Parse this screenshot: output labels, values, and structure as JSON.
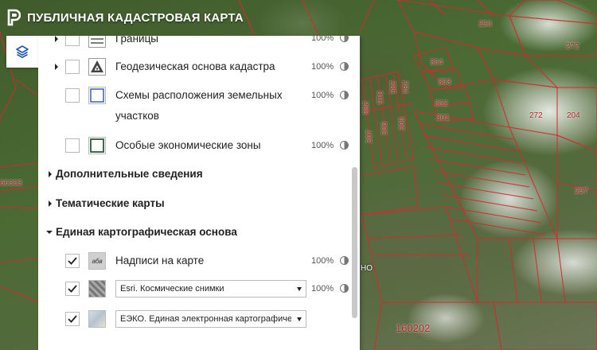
{
  "header": {
    "title": "ПУБЛИЧНАЯ КАДАСТРОВАЯ КАРТА",
    "logo_icon": "pkk-logo-icon"
  },
  "layers_button": {
    "icon": "layers-icon"
  },
  "panel": {
    "layers": [
      {
        "name": "Границы",
        "opacity": "100%",
        "checked": false,
        "expandable": true
      },
      {
        "name": "Геодезическая основа кадастра",
        "opacity": "100%",
        "checked": false,
        "expandable": true
      },
      {
        "name_line1": "Схемы расположения земельных",
        "name_line2": "участков",
        "opacity": "100%",
        "checked": false
      },
      {
        "name": "Особые экономические зоны",
        "opacity": "100%",
        "checked": false
      }
    ],
    "sections": {
      "additional": "Дополнительные сведения",
      "thematic": "Тематические карты",
      "base": "Единая картографическая основа"
    },
    "base_layers": [
      {
        "name": "Надписи на карте",
        "opacity": "100%",
        "checked": true,
        "icon_text": "абв"
      },
      {
        "select_value": "Esri. Космические снимки",
        "opacity": "100%",
        "checked": true
      },
      {
        "select_value": "ЕЭКО. Единая электронная картографическ",
        "checked": true
      }
    ]
  },
  "map_labels": [
    "250",
    "272",
    "304",
    "303",
    "302",
    "301",
    "272",
    "204",
    "257",
    "285",
    "284",
    "315",
    "286",
    "307",
    "306",
    "305",
    "60303",
    "160202",
    "НО"
  ],
  "colors": {
    "parcel_border": "#d42a2f",
    "panel_bg": "#ffffff",
    "accent": "#1e5aa6"
  }
}
